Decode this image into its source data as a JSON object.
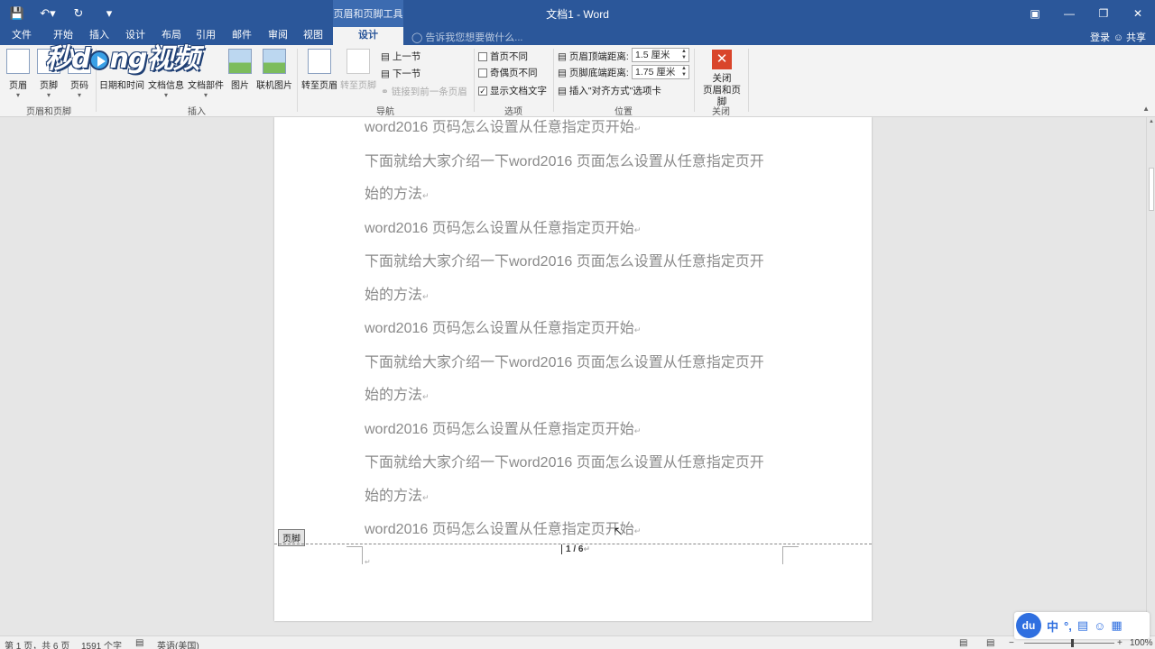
{
  "window": {
    "title": "文档1 - Word",
    "context_tool": "页眉和页脚工具"
  },
  "qat": {
    "save_icon": "save-icon",
    "undo_icon": "undo-icon",
    "redo_icon": "redo-icon"
  },
  "tabs": [
    {
      "label": "文件"
    },
    {
      "label": "开始"
    },
    {
      "label": "插入"
    },
    {
      "label": "设计"
    },
    {
      "label": "布局"
    },
    {
      "label": "引用"
    },
    {
      "label": "邮件"
    },
    {
      "label": "审阅"
    },
    {
      "label": "视图"
    },
    {
      "label": "设计"
    }
  ],
  "tellme": "告诉我您想要做什么...",
  "account": {
    "login": "登录",
    "share": "共享"
  },
  "ribbon": {
    "groups": {
      "header_footer": "页眉和页脚",
      "insert": "插入",
      "nav": "导航",
      "options": "选项",
      "position": "位置",
      "close": "关闭"
    },
    "buttons": {
      "header": "页眉",
      "footer": "页脚",
      "page_number": "页码",
      "date_time": "日期和时间",
      "doc_info": "文档信息",
      "doc_parts": "文档部件",
      "picture": "图片",
      "online_picture": "联机图片",
      "goto_header": "转至页眉",
      "goto_footer": "转至页脚",
      "prev_section": "上一节",
      "next_section": "下一节",
      "link_previous": "链接到前一条页眉",
      "diff_first": "首页不同",
      "diff_odd_even": "奇偶页不同",
      "show_doc_text": "显示文档文字",
      "header_from_top_label": "页眉顶端距离:",
      "header_from_top_value": "1.5 厘米",
      "footer_from_bottom_label": "页脚底端距离:",
      "footer_from_bottom_value": "1.75 厘米",
      "insert_align_tab": "插入\"对齐方式\"选项卡",
      "close_line1": "关闭",
      "close_line2": "页眉和页脚"
    },
    "checks": {
      "diff_first": false,
      "diff_odd_even": false,
      "show_doc_text": true
    }
  },
  "document": {
    "paragraphs": [
      "word2016 页码怎么设置从任意指定页开始",
      "下面就给大家介绍一下word2016 页面怎么设置从任意指定页开",
      "始的方法",
      "word2016 页码怎么设置从任意指定页开始",
      "下面就给大家介绍一下word2016 页面怎么设置从任意指定页开",
      "始的方法",
      "word2016 页码怎么设置从任意指定页开始",
      "下面就给大家介绍一下word2016 页面怎么设置从任意指定页开",
      "始的方法",
      "word2016 页码怎么设置从任意指定页开始",
      "下面就给大家介绍一下word2016 页面怎么设置从任意指定页开",
      "始的方法",
      "word2016 页码怎么设置从任意指定页开始"
    ],
    "footer_tag": "页脚",
    "page_number": "1 / 6"
  },
  "status": {
    "page": "第 1 页，共 6 页",
    "words": "1591 个字",
    "language": "英语(美国)",
    "zoom": "100%"
  },
  "logo_text": "秒懂视频",
  "ime": {
    "logo": "du",
    "mode": "中",
    "punct": "°,"
  }
}
